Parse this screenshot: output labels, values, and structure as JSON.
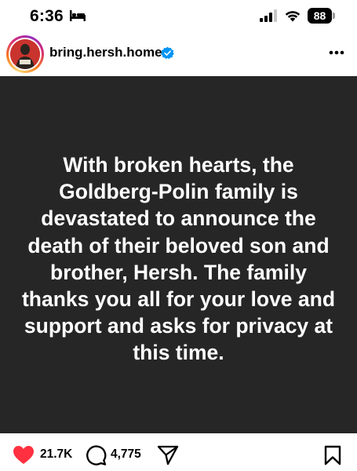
{
  "status_bar": {
    "time": "6:36",
    "battery": "88",
    "icons": [
      "bed-icon",
      "signal-icon",
      "wifi-icon",
      "battery-icon"
    ]
  },
  "post": {
    "username": "bring.hersh.home",
    "verified": true,
    "text": "With broken hearts, the Goldberg-Polin family is devastated to announce the death of their beloved son and brother, Hersh. The family thanks you all for your love and support and asks for privacy at this time.",
    "background_color": "#262626",
    "text_color": "#ffffff"
  },
  "actions": {
    "likes": "21.7K",
    "comments": "4,775",
    "icons": [
      "heart-icon",
      "comment-icon",
      "share-icon",
      "bookmark-icon"
    ],
    "heart_color": "#ff3040"
  },
  "colors": {
    "verified_blue": "#0095f6"
  }
}
